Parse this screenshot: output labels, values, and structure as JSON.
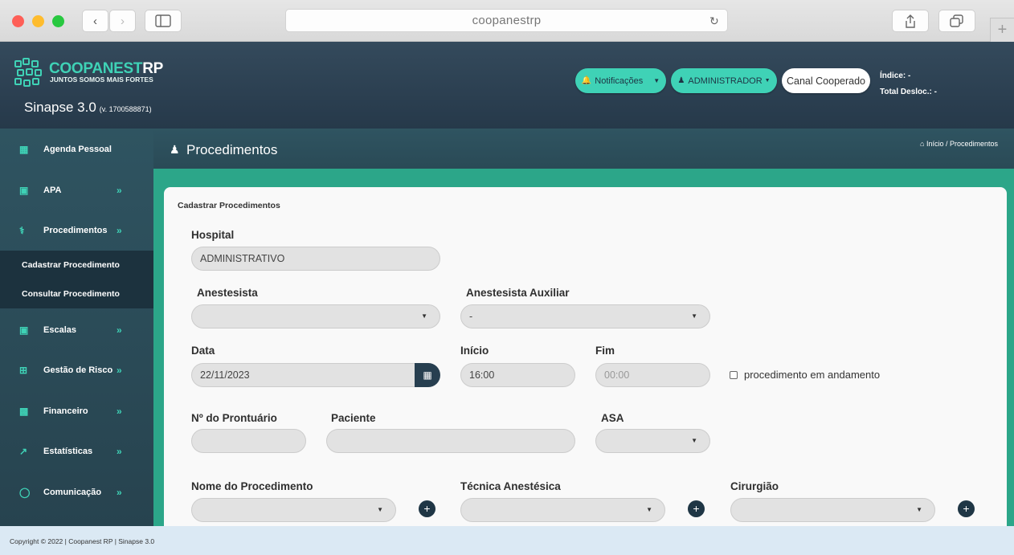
{
  "browser": {
    "address": "coopanestrp"
  },
  "brand": {
    "name_part1": "COOPANEST",
    "name_part2": "RP",
    "tagline": "JUNTOS SOMOS MAIS FORTES",
    "app_name": "Sinapse 3.0",
    "version": "(v. 1700588871)",
    "accent": "#3fd2b6"
  },
  "topbar": {
    "notifications_label": "Notificações",
    "user_label": "ADMINISTRADOR",
    "channel_label": "Canal Cooperado",
    "index_label": "Índice: -",
    "total_label": "Total Desloc.: -"
  },
  "sidebar": {
    "items": [
      {
        "label": "Agenda Pessoal",
        "icon": "calendar-grid-icon"
      },
      {
        "label": "APA",
        "icon": "calendar-icon"
      },
      {
        "label": "Procedimentos",
        "icon": "stethoscope-icon"
      },
      {
        "label": "Escalas",
        "icon": "calendar-icon"
      },
      {
        "label": "Gestão de Risco",
        "icon": "plus-square-icon"
      },
      {
        "label": "Financeiro",
        "icon": "money-icon"
      },
      {
        "label": "Estatísticas",
        "icon": "chart-line-icon"
      },
      {
        "label": "Comunicação",
        "icon": "comment-icon"
      }
    ],
    "subitems": [
      "Cadastrar Procedimento",
      "Consultar Procedimento"
    ]
  },
  "page": {
    "title": "Procedimentos",
    "breadcrumb": "Início / Procedimentos"
  },
  "form": {
    "card_title": "Cadastrar Procedimentos",
    "hospital_label": "Hospital",
    "hospital_value": "ADMINISTRATIVO",
    "anestesista_label": "Anestesista",
    "anestesista_value": "",
    "auxiliar_label": "Anestesista Auxiliar",
    "auxiliar_value": "-",
    "data_label": "Data",
    "data_value": "22/11/2023",
    "inicio_label": "Início",
    "inicio_value": "16:00",
    "fim_label": "Fim",
    "fim_value": "00:00",
    "andamento_label": "procedimento em andamento",
    "prontuario_label": "Nº do Prontuário",
    "paciente_label": "Paciente",
    "asa_label": "ASA",
    "nome_proc_label": "Nome do Procedimento",
    "tecnica_label": "Técnica Anestésica",
    "cirurgiao_label": "Cirurgião"
  },
  "footer": {
    "copyright": "Copyright © 2022 | Coopanest RP | Sinapse 3.0"
  }
}
